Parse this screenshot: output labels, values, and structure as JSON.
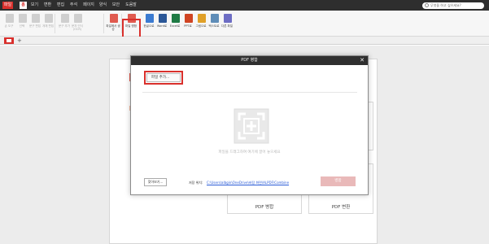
{
  "menubar": {
    "items": [
      "파일",
      "홈",
      "보기",
      "변환",
      "편집",
      "주석",
      "페이지",
      "양식",
      "보안",
      "도움말"
    ],
    "search_placeholder": "무엇을 하고 싶으세요?"
  },
  "ribbon": {
    "buttons": [
      {
        "label": "손 도구",
        "icon": "hand-icon",
        "color": "#cfcfcf",
        "dim": true
      },
      {
        "label": "선택",
        "icon": "cursor-icon",
        "color": "#cfcfcf",
        "dim": true
      },
      {
        "label": "문구 편집",
        "icon": "text-edit-icon",
        "color": "#cfcfcf",
        "dim": true
      },
      {
        "label": "개체 편집",
        "icon": "object-edit-icon",
        "color": "#cfcfcf",
        "dim": true
      },
      {
        "label": "문구 추가",
        "icon": "add-text-icon",
        "color": "#cfcfcf",
        "dim": true
      },
      {
        "label": "문자 인식(OCR)",
        "icon": "ocr-icon",
        "color": "#cfcfcf",
        "dim": true
      },
      {
        "label": "파일에서 생성",
        "icon": "create-from-file-icon",
        "color": "#e05a4f",
        "dim": false
      },
      {
        "label": "파일 병합",
        "icon": "merge-files-icon",
        "color": "#e05a4f",
        "dim": false
      },
      {
        "label": "한글으로",
        "icon": "to-hwp-icon",
        "color": "#3b7bd1",
        "dim": false
      },
      {
        "label": "Word로",
        "icon": "to-word-icon",
        "color": "#2b5797",
        "dim": false
      },
      {
        "label": "Excel로",
        "icon": "to-excel-icon",
        "color": "#1f7a44",
        "dim": false
      },
      {
        "label": "PPT로",
        "icon": "to-ppt-icon",
        "color": "#d04423",
        "dim": false
      },
      {
        "label": "그림으로",
        "icon": "to-image-icon",
        "color": "#e0a028",
        "dim": false
      },
      {
        "label": "텍스트로",
        "icon": "to-text-icon",
        "color": "#5f8db8",
        "dim": false
      },
      {
        "label": "다른 파일",
        "icon": "other-file-icon",
        "color": "#6d6dc4",
        "dim": false
      }
    ]
  },
  "tabs": {
    "home_icon": "home-icon",
    "add_icon": "plus-icon"
  },
  "background": {
    "merge_tile_label": "PDF 병합",
    "convert_tile_label": "PDF 변환"
  },
  "modal": {
    "title": "PDF 병합",
    "close": "✕",
    "add_file_button": "파일 추가...",
    "drop_hint": "파일을 드래그하여 여기에 끌어 놓으세요",
    "browse_button": "찾아보기...",
    "save_location_label": "저장 위치:",
    "save_location_path": "C:\\Users\\albgin\\OneDrive\\바탕 화면\\ALPDF\\Combine",
    "merge_button": "병합"
  },
  "colors": {
    "accent": "#d9302c",
    "menubar": "#2e2e2e",
    "modal_titlebar": "#2f2f2f"
  }
}
